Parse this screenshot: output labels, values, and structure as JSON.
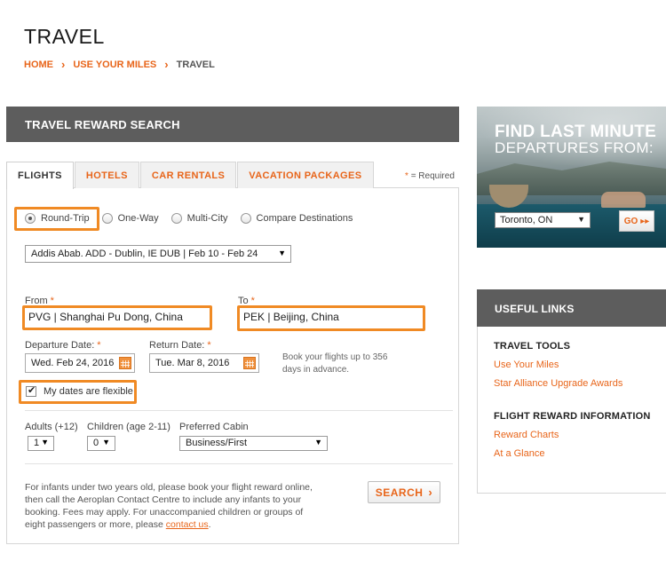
{
  "page": {
    "title": "TRAVEL"
  },
  "breadcrumb": {
    "items": [
      "HOME",
      "USE YOUR MILES",
      "TRAVEL"
    ],
    "separator": "›"
  },
  "search_panel": {
    "header": "TRAVEL REWARD SEARCH"
  },
  "tabs": [
    {
      "label": "FLIGHTS",
      "active": true
    },
    {
      "label": "HOTELS",
      "active": false
    },
    {
      "label": "CAR RENTALS",
      "active": false
    },
    {
      "label": "VACATION PACKAGES",
      "active": false
    }
  ],
  "required_note": {
    "star": "*",
    "text": "= Required"
  },
  "trip_type": {
    "options": [
      "Round-Trip",
      "One-Way",
      "Multi-City",
      "Compare Destinations"
    ],
    "selected": "Round-Trip"
  },
  "recent_search": {
    "value": "Addis Abab. ADD - Dublin, IE DUB | Feb 10 - Feb 24"
  },
  "from": {
    "label": "From",
    "required": "*",
    "value": "PVG | Shanghai Pu Dong, China"
  },
  "to": {
    "label": "To",
    "required": "*",
    "value": "PEK | Beijing, China"
  },
  "departure": {
    "label": "Departure Date:",
    "required": "*",
    "value": "Wed. Feb 24, 2016"
  },
  "return": {
    "label": "Return Date:",
    "required": "*",
    "value": "Tue. Mar 8, 2016"
  },
  "advance_note": "Book your flights up to 356 days in advance.",
  "flexible_dates": {
    "label": "My dates are flexible",
    "checked": true
  },
  "adults": {
    "label": "Adults (+12)",
    "value": "1"
  },
  "children": {
    "label": "Children (age 2-11)",
    "value": "0"
  },
  "cabin": {
    "label": "Preferred Cabin",
    "value": "Business/First"
  },
  "infant_note": {
    "text": "For infants under two years old, please book your flight reward online, then call the Aeroplan Contact Centre to include any infants to your booking. Fees may apply. For unaccompanied children or groups of eight passengers or more, please ",
    "link": "contact us",
    "end": "."
  },
  "search_button": {
    "label": "SEARCH",
    "icon": "chevron-right-icon"
  },
  "promo": {
    "title": "FIND LAST MINUTE",
    "subtitle": "DEPARTURES FROM:",
    "origin_value": "Toronto, ON",
    "go_label": "GO",
    "go_icon": "double-chevron-right-icon"
  },
  "useful_links": {
    "header": "USEFUL LINKS",
    "sections": [
      {
        "title": "TRAVEL TOOLS",
        "links": [
          "Use Your Miles",
          "Star Alliance Upgrade Awards"
        ]
      },
      {
        "title": "FLIGHT REWARD INFORMATION",
        "links": [
          "Reward Charts",
          "At a Glance"
        ]
      }
    ]
  },
  "colors": {
    "accent": "#e8651a",
    "highlight": "#f08a24",
    "header_bg": "#5d5d5d"
  }
}
